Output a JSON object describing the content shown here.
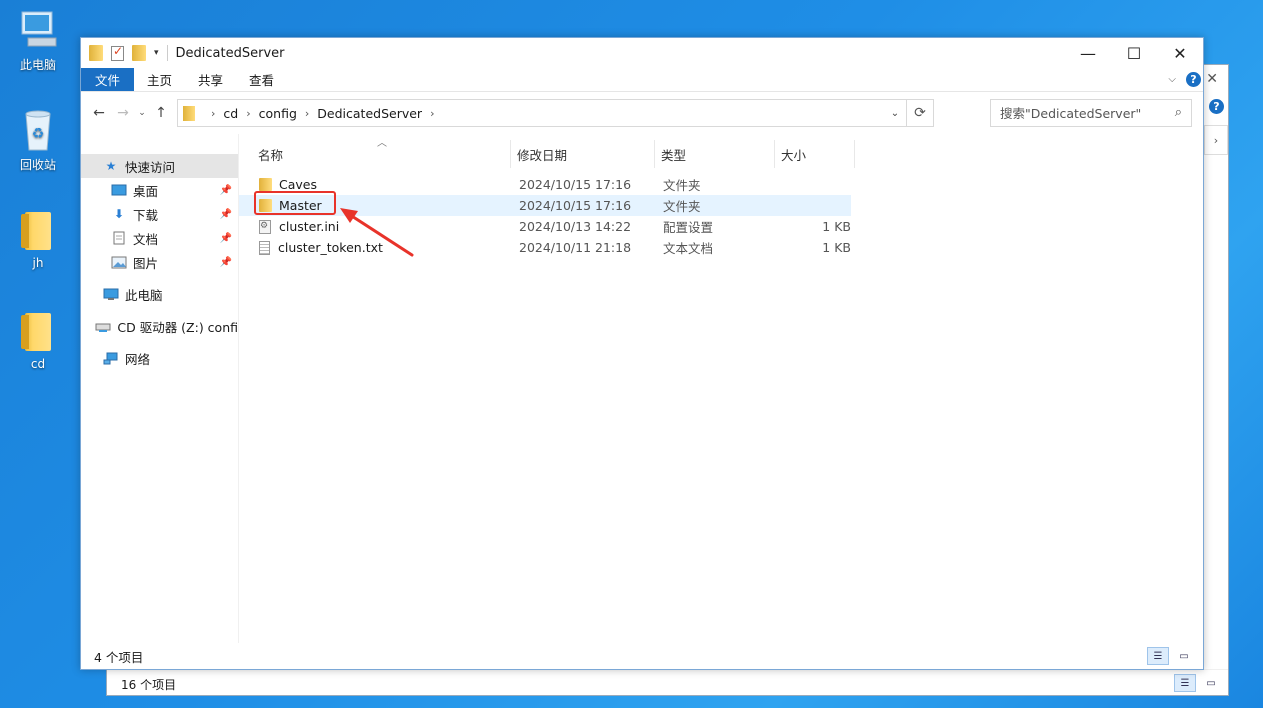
{
  "desktop": {
    "icons": [
      {
        "label": "此电脑"
      },
      {
        "label": "回收站"
      },
      {
        "label": "jh"
      },
      {
        "label": "cd"
      }
    ]
  },
  "window": {
    "title": "DedicatedServer",
    "controls": {
      "minimize": "—",
      "maximize": "☐",
      "close": "✕"
    }
  },
  "ribbon": {
    "tabs": [
      {
        "label": "文件"
      },
      {
        "label": "主页"
      },
      {
        "label": "共享"
      },
      {
        "label": "查看"
      }
    ],
    "help": "?"
  },
  "address": {
    "crumbs": [
      "cd",
      "config",
      "DedicatedServer"
    ],
    "search_placeholder": "搜索\"DedicatedServer\""
  },
  "navpane": {
    "quick_access": "快速访问",
    "pinned": [
      {
        "label": "桌面",
        "icon": "desktop-icon"
      },
      {
        "label": "下载",
        "icon": "download-icon"
      },
      {
        "label": "文档",
        "icon": "document-icon"
      },
      {
        "label": "图片",
        "icon": "picture-icon"
      }
    ],
    "this_pc": "此电脑",
    "cd_drive": "CD 驱动器 (Z:) confi",
    "network": "网络"
  },
  "columns": {
    "name": "名称",
    "modified": "修改日期",
    "type": "类型",
    "size": "大小"
  },
  "files": [
    {
      "name": "Caves",
      "date": "2024/10/15 17:16",
      "type": "文件夹",
      "size": "",
      "icon": "folder-icon"
    },
    {
      "name": "Master",
      "date": "2024/10/15 17:16",
      "type": "文件夹",
      "size": "",
      "icon": "folder-icon"
    },
    {
      "name": "cluster.ini",
      "date": "2024/10/13 14:22",
      "type": "配置设置",
      "size": "1 KB",
      "icon": "ini-file-icon"
    },
    {
      "name": "cluster_token.txt",
      "date": "2024/10/11 21:18",
      "type": "文本文档",
      "size": "1 KB",
      "icon": "text-file-icon"
    }
  ],
  "status": {
    "item_count": "4 个项目",
    "back_item_count": "16 个项目"
  },
  "annotation_color": "#e8332a"
}
